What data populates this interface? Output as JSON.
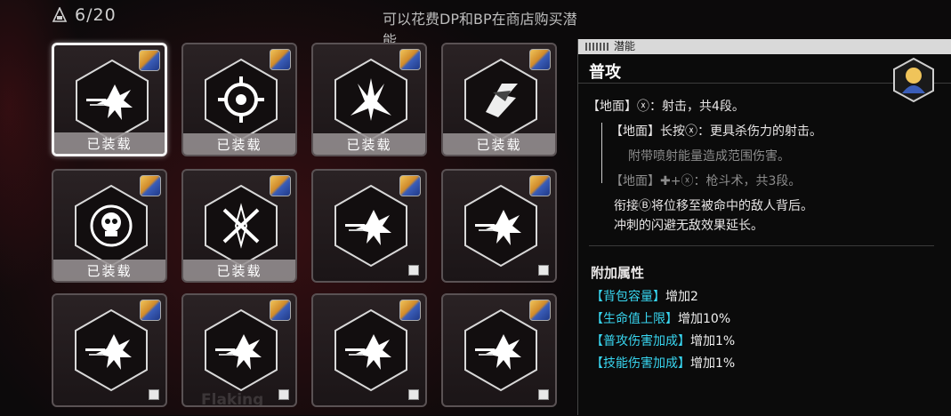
{
  "header": {
    "count": "6/20",
    "notice": "可以花费DP和BP在商店购买潜能"
  },
  "cards": [
    {
      "icon": "burst-shot-icon",
      "equipped": true
    },
    {
      "icon": "crosshair-icon",
      "equipped": true
    },
    {
      "icon": "spike-burst-icon",
      "equipped": true
    },
    {
      "icon": "claw-strike-icon",
      "equipped": true
    },
    {
      "icon": "skull-emblem-icon",
      "equipped": true
    },
    {
      "icon": "crossed-blades-icon",
      "equipped": true
    },
    {
      "icon": "burst-shot-icon",
      "equipped": false
    },
    {
      "icon": "burst-shot-icon",
      "equipped": false
    },
    {
      "icon": "burst-shot-icon",
      "equipped": false
    },
    {
      "icon": "burst-shot-icon",
      "equipped": false
    },
    {
      "icon": "burst-shot-icon",
      "equipped": false
    },
    {
      "icon": "burst-shot-icon",
      "equipped": false
    }
  ],
  "equipped_label": "已装载",
  "faded_text": "Flaking",
  "panel": {
    "tab": "潜能",
    "title": "普攻",
    "lines": {
      "l1": "【地面】ⓧ：射击，共4段。",
      "l2": "【地面】长按ⓧ：更具杀伤力的射击。",
      "l3": "附带喷射能量造成范围伤害。",
      "l4": "【地面】✚+ⓧ：枪斗术，共3段。",
      "l5": "衔接Ⓑ将位移至被命中的敌人背后。",
      "l6": "冲刺的闪避无敌效果延长。"
    },
    "section": "附加属性",
    "attrs": [
      {
        "k": "【背包容量】",
        "v": "增加2"
      },
      {
        "k": "【生命值上限】",
        "v": "增加10%"
      },
      {
        "k": "【普攻伤害加成】",
        "v": "增加1%"
      },
      {
        "k": "【技能伤害加成】",
        "v": "增加1%"
      }
    ]
  },
  "colors": {
    "accent": "#38d6f0",
    "equipped_bar": "#969192",
    "selected_border": "#f4f4f4"
  }
}
